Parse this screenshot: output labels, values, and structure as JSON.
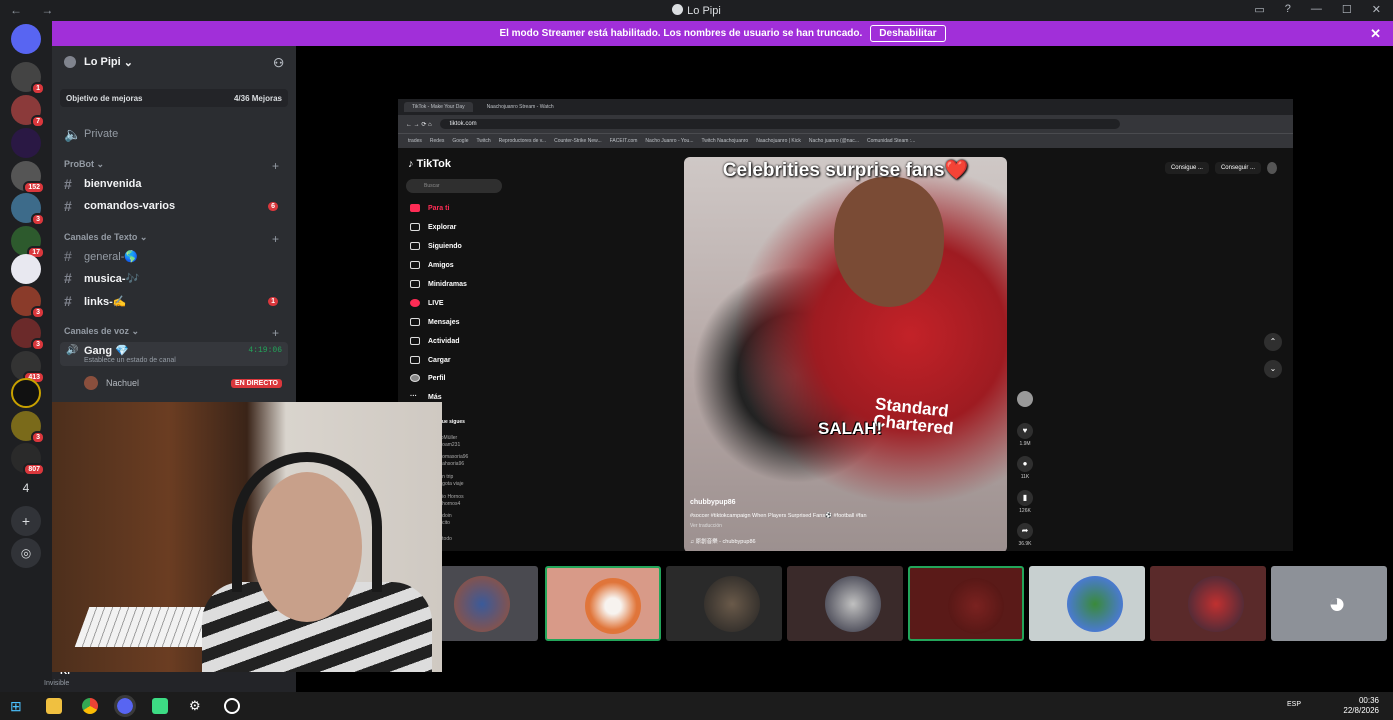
{
  "window": {
    "title": "Lo Pipi"
  },
  "banner": {
    "text": "El modo Streamer está habilitado. Los nombres de usuario se han truncado.",
    "button": "Deshabilitar"
  },
  "servers": [
    {
      "badge": "1"
    },
    {
      "badge": "7"
    },
    {
      "badge": ""
    },
    {
      "badge": "152"
    },
    {
      "badge": "3"
    },
    {
      "badge": "17"
    },
    {
      "badge": ""
    },
    {
      "badge": "3"
    },
    {
      "badge": "3"
    },
    {
      "badge": "413"
    },
    {
      "badge": ""
    },
    {
      "badge": "3"
    },
    {
      "badge": "807"
    }
  ],
  "server_extra": {
    "number": "4"
  },
  "sidebar": {
    "server_name": "Lo Pipi",
    "boost_label": "Objetivo de mejoras",
    "boost_count": "4/36 Mejoras",
    "private": "Private",
    "cat_probot": "ProBot",
    "ch_bienvenida": "bienvenida",
    "ch_comandos": "comandos-varios",
    "ch_comandos_count": "6",
    "cat_texto": "Canales de Texto",
    "ch_general": "general-🌎",
    "ch_musica": "musica-🎶",
    "ch_links": "links-✍",
    "ch_links_count": "1",
    "cat_voz": "Canales de voz",
    "voice_name": "Gang 💎",
    "voice_time": "4:19:06",
    "voice_status": "Establece un estado de canal",
    "member_name": "Nachuel",
    "live_label": "EN DIRECTO",
    "user_status": "Invisible",
    "voice_conn": "Vo",
    "user_name": "Kl"
  },
  "browser": {
    "tab1": "TikTok - Make Your Day",
    "tab2": "Naachojuanro Stream - Watch",
    "url": "tiktok.com",
    "bookmarks": [
      "trades",
      "Redes",
      "Google",
      "Twitch",
      "Reproductores de v...",
      "Counter-Strike New...",
      "FACEIT.com",
      "Nacho Juanro - You...",
      "Twitch Naachojuanro",
      "Naachojuanro | Kick",
      "Nacho juanro (@nac...",
      "Comunidad Steam :..."
    ]
  },
  "tiktok": {
    "logo": "TikTok",
    "search": "Buscar",
    "menu": [
      "Para ti",
      "Explorar",
      "Siguiendo",
      "Amigos",
      "Minidramas",
      "LIVE",
      "Mensajes",
      "Actividad",
      "Cargar",
      "Perfil",
      "Más"
    ],
    "following_title": "Que sigues",
    "following": [
      "noMüller",
      "...oam231",
      "...omasoria96",
      "...ahsoria96",
      "...n trip",
      "...gota viaje",
      "...io Hornos",
      "...hornos4",
      "...doin",
      "...cito",
      "...todo"
    ],
    "top_buttons": [
      "Consigue ...",
      "Conseguir ..."
    ],
    "video_caption": "Celebrities surprise fans❤️",
    "video_text1": "SALAH!",
    "video_text2": "Standard Chartered",
    "video_user": "chubbypup86",
    "video_desc": "#soccer #tiktokcampaign When Players Surprised Fans⚽ #football #fan",
    "video_trans": "Ver traducción",
    "video_music": "♫ 原創音樂 - chubbypup86",
    "likes": "1.9M",
    "comments": "11K",
    "saves": "126K",
    "shares": "36.9K"
  },
  "colors": {
    "banner": "#a12fd9",
    "discord_bg": "#2b2d31",
    "live_red": "#da373c",
    "voice_green": "#23a55a",
    "tiktok_red": "#fe2c55"
  },
  "taskbar": {
    "lang": "ESP",
    "time": "00:36",
    "date": "22/8/2026"
  }
}
